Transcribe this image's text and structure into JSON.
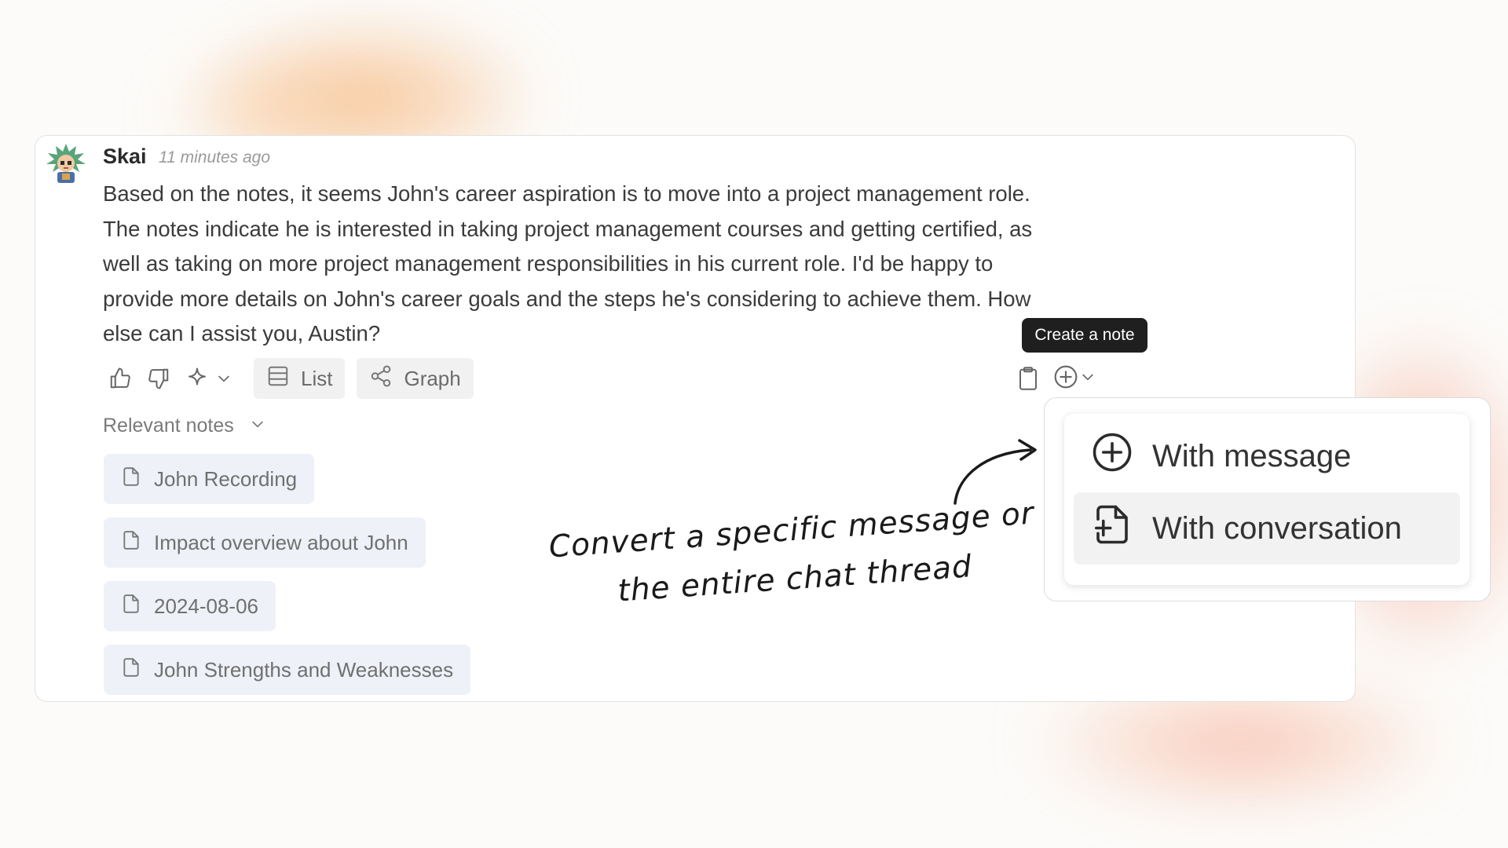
{
  "message": {
    "author": "Skai",
    "timestamp": "11 minutes ago",
    "lines": [
      "Based on the notes, it seems John's career aspiration is to move into a project management role.",
      "The notes indicate he is interested in taking project management courses and getting certified, as",
      "well as taking on more project management responsibilities in his current role. I'd be happy to",
      "provide more details on John's career goals and the steps he's considering to achieve them. How",
      "else can I assist you, Austin?"
    ]
  },
  "toolbar": {
    "list_label": "List",
    "graph_label": "Graph",
    "icons": [
      "thumbs-up-icon",
      "thumbs-down-icon",
      "sparkle-icon",
      "chevron-down-icon",
      "list-icon",
      "share-graph-icon",
      "clipboard-icon",
      "plus-circle-icon"
    ]
  },
  "relevant_notes": {
    "label": "Relevant notes",
    "items": [
      {
        "title": "John Recording"
      },
      {
        "title": "Impact overview about John"
      },
      {
        "title": "2024-08-06"
      },
      {
        "title": "John Strengths and Weaknesses"
      }
    ]
  },
  "tooltip": {
    "text": "Create a note"
  },
  "create_menu": {
    "items": [
      {
        "label": "With message",
        "icon": "plus-circle-icon"
      },
      {
        "label": "With conversation",
        "icon": "file-plus-icon",
        "highlighted": true
      }
    ]
  },
  "annotation": {
    "line1": "Convert a specific message or",
    "line2": "the entire chat thread"
  },
  "colors": {
    "card_border": "#e2e2e2",
    "chip_bg": "#eef1f7",
    "tooltip_bg": "#1f1f1f",
    "accent_peach": "#f6af6e",
    "accent_coral": "#f48c6e"
  }
}
